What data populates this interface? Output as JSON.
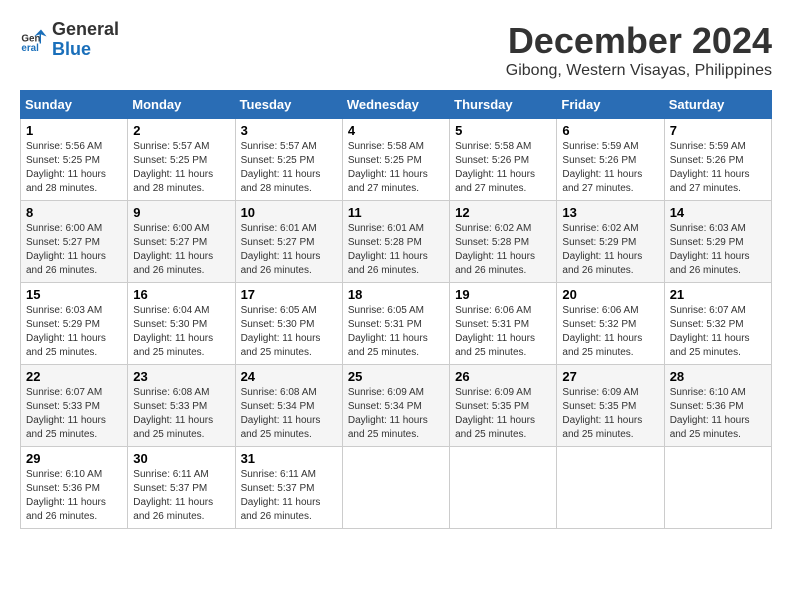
{
  "logo": {
    "general": "General",
    "blue": "Blue"
  },
  "title": {
    "month": "December 2024",
    "location": "Gibong, Western Visayas, Philippines"
  },
  "weekdays": [
    "Sunday",
    "Monday",
    "Tuesday",
    "Wednesday",
    "Thursday",
    "Friday",
    "Saturday"
  ],
  "days": [
    {
      "week": 1,
      "cells": [
        {
          "day": 1,
          "sunrise": "5:56 AM",
          "sunset": "5:25 PM",
          "daylight": "11 hours and 28 minutes."
        },
        {
          "day": 2,
          "sunrise": "5:57 AM",
          "sunset": "5:25 PM",
          "daylight": "11 hours and 28 minutes."
        },
        {
          "day": 3,
          "sunrise": "5:57 AM",
          "sunset": "5:25 PM",
          "daylight": "11 hours and 28 minutes."
        },
        {
          "day": 4,
          "sunrise": "5:58 AM",
          "sunset": "5:25 PM",
          "daylight": "11 hours and 27 minutes."
        },
        {
          "day": 5,
          "sunrise": "5:58 AM",
          "sunset": "5:26 PM",
          "daylight": "11 hours and 27 minutes."
        },
        {
          "day": 6,
          "sunrise": "5:59 AM",
          "sunset": "5:26 PM",
          "daylight": "11 hours and 27 minutes."
        },
        {
          "day": 7,
          "sunrise": "5:59 AM",
          "sunset": "5:26 PM",
          "daylight": "11 hours and 27 minutes."
        }
      ]
    },
    {
      "week": 2,
      "cells": [
        {
          "day": 8,
          "sunrise": "6:00 AM",
          "sunset": "5:27 PM",
          "daylight": "11 hours and 26 minutes."
        },
        {
          "day": 9,
          "sunrise": "6:00 AM",
          "sunset": "5:27 PM",
          "daylight": "11 hours and 26 minutes."
        },
        {
          "day": 10,
          "sunrise": "6:01 AM",
          "sunset": "5:27 PM",
          "daylight": "11 hours and 26 minutes."
        },
        {
          "day": 11,
          "sunrise": "6:01 AM",
          "sunset": "5:28 PM",
          "daylight": "11 hours and 26 minutes."
        },
        {
          "day": 12,
          "sunrise": "6:02 AM",
          "sunset": "5:28 PM",
          "daylight": "11 hours and 26 minutes."
        },
        {
          "day": 13,
          "sunrise": "6:02 AM",
          "sunset": "5:29 PM",
          "daylight": "11 hours and 26 minutes."
        },
        {
          "day": 14,
          "sunrise": "6:03 AM",
          "sunset": "5:29 PM",
          "daylight": "11 hours and 26 minutes."
        }
      ]
    },
    {
      "week": 3,
      "cells": [
        {
          "day": 15,
          "sunrise": "6:03 AM",
          "sunset": "5:29 PM",
          "daylight": "11 hours and 25 minutes."
        },
        {
          "day": 16,
          "sunrise": "6:04 AM",
          "sunset": "5:30 PM",
          "daylight": "11 hours and 25 minutes."
        },
        {
          "day": 17,
          "sunrise": "6:05 AM",
          "sunset": "5:30 PM",
          "daylight": "11 hours and 25 minutes."
        },
        {
          "day": 18,
          "sunrise": "6:05 AM",
          "sunset": "5:31 PM",
          "daylight": "11 hours and 25 minutes."
        },
        {
          "day": 19,
          "sunrise": "6:06 AM",
          "sunset": "5:31 PM",
          "daylight": "11 hours and 25 minutes."
        },
        {
          "day": 20,
          "sunrise": "6:06 AM",
          "sunset": "5:32 PM",
          "daylight": "11 hours and 25 minutes."
        },
        {
          "day": 21,
          "sunrise": "6:07 AM",
          "sunset": "5:32 PM",
          "daylight": "11 hours and 25 minutes."
        }
      ]
    },
    {
      "week": 4,
      "cells": [
        {
          "day": 22,
          "sunrise": "6:07 AM",
          "sunset": "5:33 PM",
          "daylight": "11 hours and 25 minutes."
        },
        {
          "day": 23,
          "sunrise": "6:08 AM",
          "sunset": "5:33 PM",
          "daylight": "11 hours and 25 minutes."
        },
        {
          "day": 24,
          "sunrise": "6:08 AM",
          "sunset": "5:34 PM",
          "daylight": "11 hours and 25 minutes."
        },
        {
          "day": 25,
          "sunrise": "6:09 AM",
          "sunset": "5:34 PM",
          "daylight": "11 hours and 25 minutes."
        },
        {
          "day": 26,
          "sunrise": "6:09 AM",
          "sunset": "5:35 PM",
          "daylight": "11 hours and 25 minutes."
        },
        {
          "day": 27,
          "sunrise": "6:09 AM",
          "sunset": "5:35 PM",
          "daylight": "11 hours and 25 minutes."
        },
        {
          "day": 28,
          "sunrise": "6:10 AM",
          "sunset": "5:36 PM",
          "daylight": "11 hours and 25 minutes."
        }
      ]
    },
    {
      "week": 5,
      "cells": [
        {
          "day": 29,
          "sunrise": "6:10 AM",
          "sunset": "5:36 PM",
          "daylight": "11 hours and 26 minutes."
        },
        {
          "day": 30,
          "sunrise": "6:11 AM",
          "sunset": "5:37 PM",
          "daylight": "11 hours and 26 minutes."
        },
        {
          "day": 31,
          "sunrise": "6:11 AM",
          "sunset": "5:37 PM",
          "daylight": "11 hours and 26 minutes."
        },
        null,
        null,
        null,
        null
      ]
    }
  ],
  "labels": {
    "sunrise": "Sunrise:",
    "sunset": "Sunset:",
    "daylight": "Daylight:"
  }
}
